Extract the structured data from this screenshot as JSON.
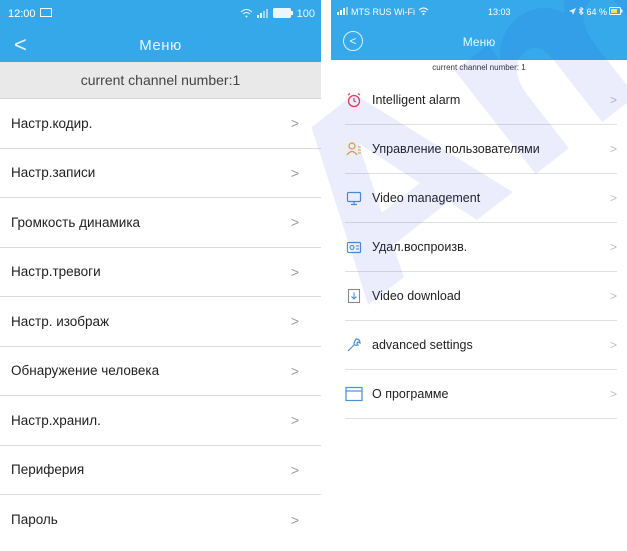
{
  "left_phone": {
    "status": {
      "time": "12:00",
      "battery": "100"
    },
    "nav": {
      "back": "<",
      "title": "Меню"
    },
    "channel": "current channel number:1",
    "chevron": ">",
    "items": [
      {
        "label": "Настр.кодир."
      },
      {
        "label": "Настр.записи"
      },
      {
        "label": "Громкость динамика"
      },
      {
        "label": "Настр.тревоги"
      },
      {
        "label": "Настр. изображ"
      },
      {
        "label": "Обнаружение человека"
      },
      {
        "label": "Настр.хранил."
      },
      {
        "label": "Периферия"
      },
      {
        "label": "Пароль"
      }
    ]
  },
  "right_phone": {
    "status": {
      "carrier": "MTS RUS Wi-Fi",
      "time": "13:03",
      "battery": "64 %"
    },
    "nav": {
      "back": "<",
      "title": "Меню"
    },
    "channel": "current channel number: 1",
    "chevron": ">",
    "items": [
      {
        "label": "Intelligent alarm",
        "icon": "alarm-clock-icon",
        "color": "#e0454a"
      },
      {
        "label": "Управление пользователями",
        "icon": "users-icon",
        "color": "#e8a42a"
      },
      {
        "label": "Video management",
        "icon": "monitor-icon",
        "color": "#4a8fd6"
      },
      {
        "label": "Удал.воспроизв.",
        "icon": "remote-playback-icon",
        "color": "#4a8fd6"
      },
      {
        "label": "Video download",
        "icon": "download-icon",
        "color": "#8a8a8a"
      },
      {
        "label": "advanced settings",
        "icon": "wrench-icon",
        "color": "#4a8fd6"
      },
      {
        "label": "О программе",
        "icon": "window-icon",
        "color": "#4a8fd6"
      }
    ]
  },
  "theme": {
    "header_blue": "#35a8ea",
    "channel_bg": "#e9e9e9"
  },
  "watermark": "Amc"
}
